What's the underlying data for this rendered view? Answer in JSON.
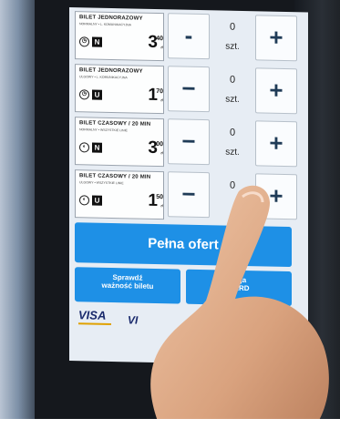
{
  "tickets": [
    {
      "title": "BILET JEDNORAZOWY",
      "subtitle": "NORMALNY • L. KOMUNIKACYJNA",
      "zone": "N",
      "price_main": "3",
      "price_sup": "40",
      "currency": "zł",
      "minus": "-",
      "qty": "0",
      "unit": "szt.",
      "plus": "+"
    },
    {
      "title": "BILET JEDNORAZOWY",
      "subtitle": "ULGOWY • L. KOMUNIKACYJNA",
      "zone": "U",
      "price_main": "1",
      "price_sup": "70",
      "currency": "zł",
      "minus": "−",
      "qty": "0",
      "unit": "szt.",
      "plus": "+"
    },
    {
      "title": "BILET CZASOWY / 20 MIN",
      "subtitle": "NORMALNY • WSZYSTKIE LINIE",
      "zone": "N",
      "price_main": "3",
      "price_sup": "00",
      "currency": "zł",
      "minus": "−",
      "qty": "0",
      "unit": "szt.",
      "plus": "+"
    },
    {
      "title": "BILET CZASOWY / 20 MIN",
      "subtitle": "ULGOWY • WSZYSTKIE LINIE",
      "zone": "U",
      "price_main": "1",
      "price_sup": "50",
      "currency": "zł",
      "minus": "−",
      "qty": "0",
      "unit": "",
      "plus": "+"
    }
  ],
  "buttons": {
    "full_offer": "Pełna ofert",
    "check_ticket": "Sprawdź\nważność biletu",
    "service": "ługa\nCARD"
  },
  "payment": {
    "visa": "VISA",
    "visa2": "VI"
  },
  "colors": {
    "accent": "#1e90e6",
    "screen_bg": "#e7edf4"
  }
}
